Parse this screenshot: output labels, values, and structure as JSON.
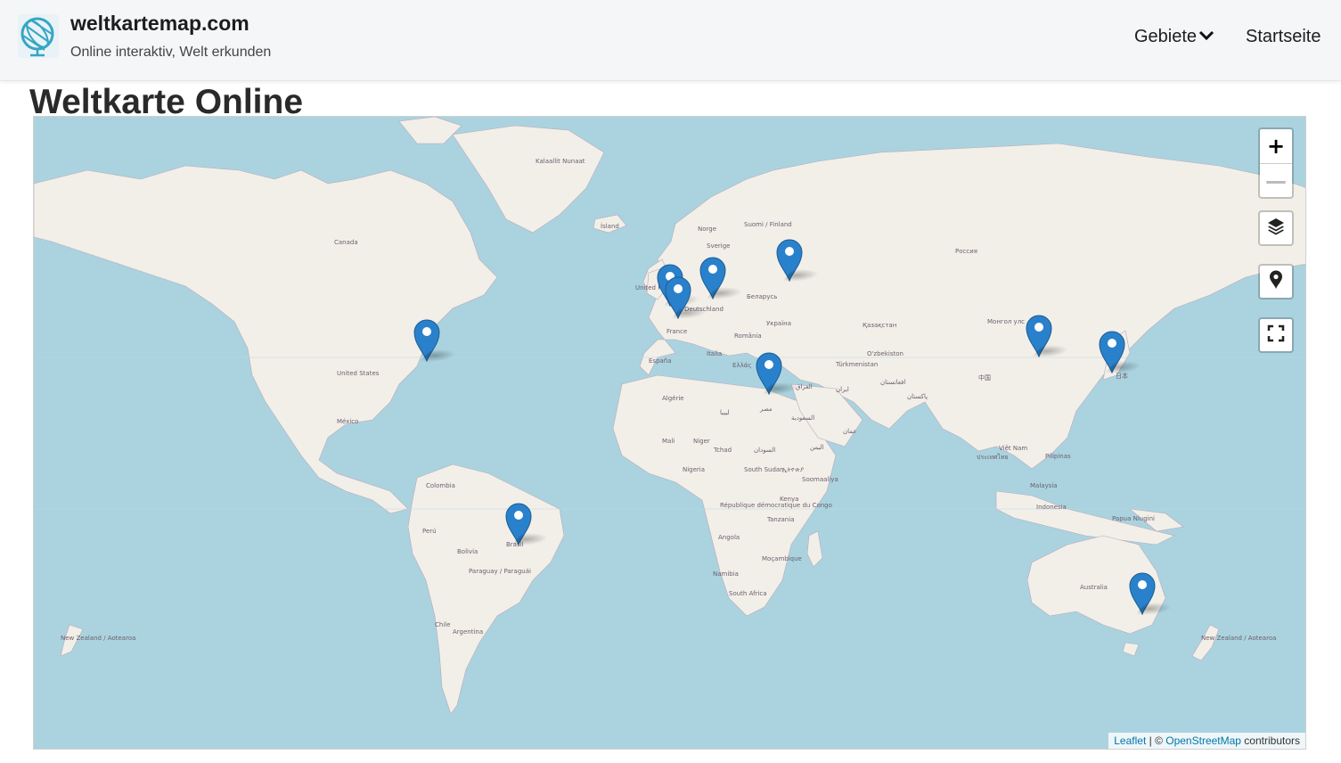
{
  "header": {
    "site_name": "weltkartemap.com",
    "tagline": "Online interaktiv, Welt erkunden",
    "nav": {
      "regions": "Gebiete",
      "home": "Startseite"
    },
    "logo_icon": "globe-icon"
  },
  "page": {
    "title": "Weltkarte Online"
  },
  "map": {
    "controls": {
      "zoom_in": "+",
      "zoom_out": "—"
    },
    "control_icons": [
      "layers-icon",
      "location-pin-icon",
      "fullscreen-icon"
    ],
    "attribution": {
      "leaflet": "Leaflet",
      "separator": " | © ",
      "osm": "OpenStreetMap",
      "suffix": " contributors"
    },
    "marker_color": "#2a81cb",
    "water_color": "#aad3df",
    "land_color": "#f2efe9",
    "labels": {
      "greenland": "Kalaallit Nunaat",
      "iceland": "Ísland",
      "canada": "Canada",
      "usa": "United States",
      "mexico": "México",
      "colombia": "Colombia",
      "peru": "Perú",
      "bolivia": "Bolivia",
      "brazil": "Brasil",
      "paraguay": "Paraguay / Paraguái",
      "chile": "Chile",
      "argentina": "Argentina",
      "norway": "Norge",
      "sweden": "Sverige",
      "finland": "Suomi / Finland",
      "uk": "United Kingdom",
      "germany": "Deutschland",
      "france": "France",
      "spain": "España",
      "italy": "Italia",
      "greece": "Ελλάς",
      "romania": "România",
      "ukraine": "Україна",
      "belarus": "Беларусь",
      "russia": "Россия",
      "kazakhstan": "Қазақстан",
      "mongolia": "Монгол улс",
      "china": "中国",
      "japan": "日本",
      "uzbekistan": "O'zbekiston",
      "turkmenistan": "Türkmenistan",
      "iran": "ایران",
      "iraq": "العراق",
      "afghanistan": "افغانستان",
      "pakistan": "پاکستان",
      "egypt": "مصر",
      "libya": "ليبيا",
      "algeria": "Algérie",
      "mali": "Mali",
      "niger": "Niger",
      "chad": "Tchad",
      "sudan": "السودان",
      "nigeria": "Nigeria",
      "south_sudan": "South Sudan",
      "ethiopia": "ኢትዮጵያ",
      "somalia": "Soomaaliya",
      "kenya": "Kenya",
      "drc": "République démocratique du Congo",
      "tanzania": "Tanzania",
      "angola": "Angola",
      "mozambique": "Moçambique",
      "namibia": "Namibia",
      "south_africa": "South Africa",
      "saudi": "السعودية",
      "yemen": "اليمن",
      "oman": "عمان",
      "vietnam": "Việt Nam",
      "thailand": "ประเทศไทย",
      "philippines": "Pilipinas",
      "malaysia": "Malaysia",
      "indonesia": "Indonesia",
      "png": "Papua Niugini",
      "australia": "Australia",
      "nz": "New Zealand / Aotearoa"
    },
    "markers": [
      "New York",
      "London",
      "Paris",
      "Berlin",
      "Moscow",
      "Cairo",
      "Beijing",
      "Tokyo",
      "Brasília",
      "Sydney"
    ]
  }
}
